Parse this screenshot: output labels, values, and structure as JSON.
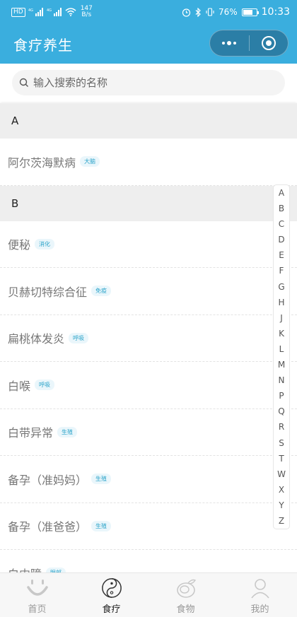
{
  "status_bar": {
    "hd": "HD",
    "net1": "4G",
    "net2": "4G",
    "speed_value": "147",
    "speed_unit": "B/s",
    "battery": "76%",
    "battery_level": 0.76,
    "time": "10:33"
  },
  "nav": {
    "title": "食疗养生"
  },
  "search": {
    "placeholder": "输入搜索的名称"
  },
  "sections": [
    {
      "letter": "A",
      "items": [
        {
          "name": "阿尔茨海默病",
          "tag": "大脑"
        }
      ]
    },
    {
      "letter": "B",
      "items": [
        {
          "name": "便秘",
          "tag": "消化"
        },
        {
          "name": "贝赫切特综合征",
          "tag": "免疫"
        },
        {
          "name": "扁桃体发炎",
          "tag": "呼吸"
        },
        {
          "name": "白喉",
          "tag": "呼吸"
        },
        {
          "name": "白带异常",
          "tag": "生殖"
        },
        {
          "name": "备孕（准妈妈）",
          "tag": "生殖"
        },
        {
          "name": "备孕（准爸爸）",
          "tag": "生殖"
        },
        {
          "name": "白内障",
          "tag": "眼部"
        }
      ]
    }
  ],
  "index_letters": [
    "A",
    "B",
    "C",
    "D",
    "E",
    "F",
    "G",
    "H",
    "J",
    "K",
    "L",
    "M",
    "N",
    "P",
    "Q",
    "R",
    "S",
    "T",
    "W",
    "X",
    "Y",
    "Z"
  ],
  "tabs": [
    {
      "label": "首页",
      "icon": "smile-icon",
      "active": false
    },
    {
      "label": "食疗",
      "icon": "yin-yang-icon",
      "active": true
    },
    {
      "label": "食物",
      "icon": "fruit-icon",
      "active": false
    },
    {
      "label": "我的",
      "icon": "person-icon",
      "active": false
    }
  ]
}
